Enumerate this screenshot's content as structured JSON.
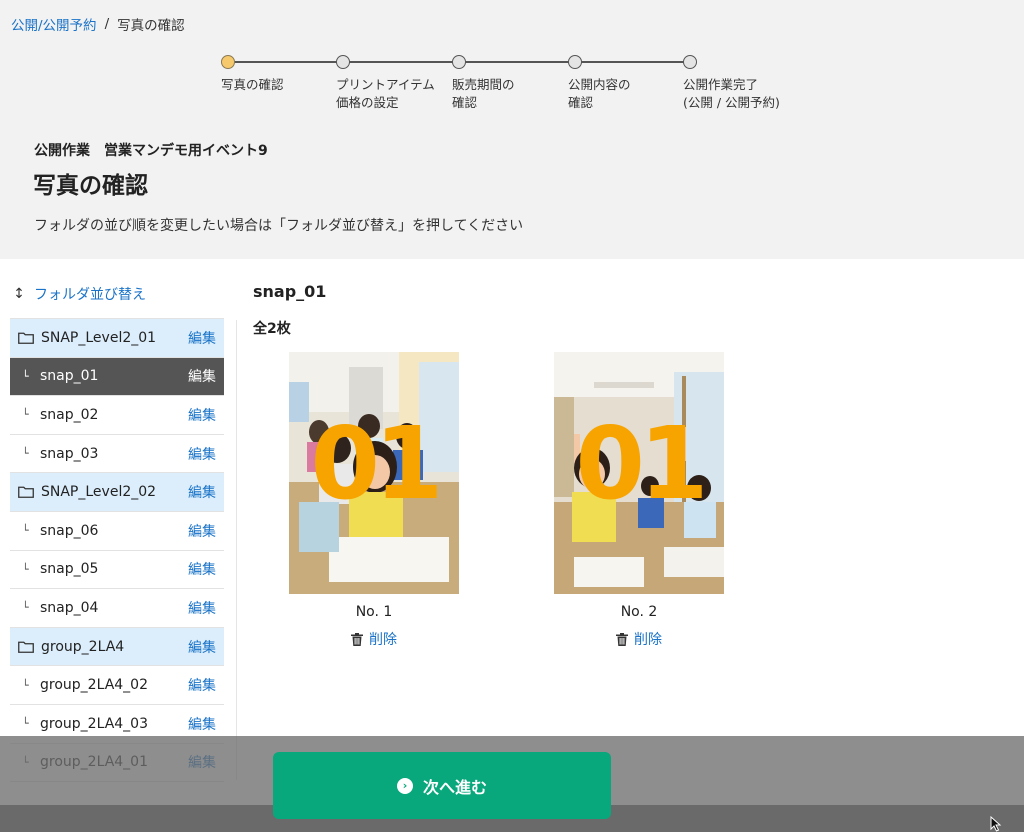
{
  "breadcrumb": {
    "link_label": "公開/公開予約",
    "separator": "/",
    "current": "写真の確認"
  },
  "stepper": {
    "steps": [
      {
        "label": "写真の確認",
        "active": true
      },
      {
        "label": "プリントアイテム\n価格の設定",
        "active": false
      },
      {
        "label": "販売期間の\n確認",
        "active": false
      },
      {
        "label": "公開内容の\n確認",
        "active": false
      },
      {
        "label": "公開作業完了\n(公開 / 公開予約)",
        "active": false
      }
    ]
  },
  "header": {
    "event_title": "公開作業　営業マンデモ用イベント9",
    "page_title": "写真の確認",
    "instruction": "フォルダの並び順を変更したい場合は「フォルダ並び替え」を押してください"
  },
  "sidebar": {
    "sort_icon": "updown-arrow-icon",
    "sort_label": "フォルダ並び替え",
    "edit_label": "編集",
    "folders": [
      {
        "name": "SNAP_Level2_01",
        "level": "parent"
      },
      {
        "name": "snap_01",
        "level": "child",
        "selected": true
      },
      {
        "name": "snap_02",
        "level": "child"
      },
      {
        "name": "snap_03",
        "level": "child"
      },
      {
        "name": "SNAP_Level2_02",
        "level": "parent"
      },
      {
        "name": "snap_06",
        "level": "child"
      },
      {
        "name": "snap_05",
        "level": "child"
      },
      {
        "name": "snap_04",
        "level": "child"
      },
      {
        "name": "group_2LA4",
        "level": "parent"
      },
      {
        "name": "group_2LA4_02",
        "level": "child"
      },
      {
        "name": "group_2LA4_03",
        "level": "child"
      },
      {
        "name": "group_2LA4_01",
        "level": "child"
      }
    ]
  },
  "content": {
    "folder_title": "snap_01",
    "count_label": "全2枚",
    "photos": [
      {
        "overlay": "01",
        "number_label": "No. 1",
        "delete_label": "削除"
      },
      {
        "overlay": "01",
        "number_label": "No. 2",
        "delete_label": "削除"
      }
    ]
  },
  "footer": {
    "next_label": "次へ進む",
    "next_icon": "chevron-right-circle-icon"
  },
  "colors": {
    "accent_link": "#1a73c8",
    "primary_button": "#08a77c",
    "active_step": "#f6c96c",
    "overlay_number": "#f7a400",
    "selected_row": "#555555",
    "parent_row": "#dceefc"
  }
}
